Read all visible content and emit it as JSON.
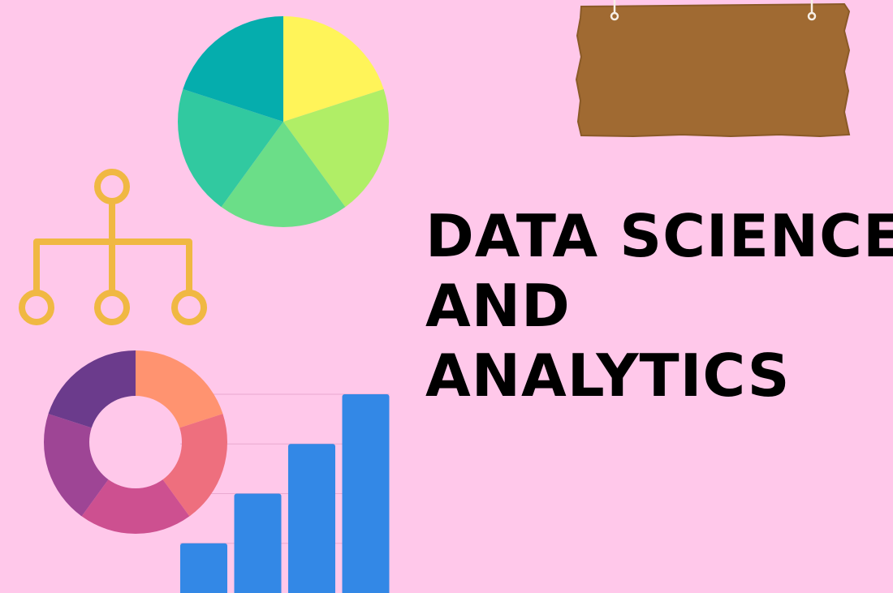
{
  "colors": {
    "background": "#ffc8ea",
    "sign_wood": "#a06a32",
    "sign_wood_dark": "#8a5a28",
    "sign_hanger": "#f7efe6",
    "hierarchy_icon": "#f0b843",
    "bars": "#3388e6",
    "title_text": "#000000",
    "pie_slices": [
      "#fff459",
      "#b0ee66",
      "#6bde88",
      "#31c9a0",
      "#05adad"
    ],
    "donut_slices": [
      "#ff9370",
      "#ee6f7e",
      "#cd5090",
      "#9e4595",
      "#6b3b8c"
    ]
  },
  "icons": {
    "sign": "wooden-sign-icon",
    "hierarchy": "org-chart-icon"
  },
  "headline": {
    "lines": [
      "DATA SCIENCE",
      "AND",
      "ANALYTICS"
    ]
  },
  "chart_data": [
    {
      "type": "pie",
      "slices": [
        {
          "color": "#fff459",
          "value": 20
        },
        {
          "color": "#b0ee66",
          "value": 20
        },
        {
          "color": "#6bde88",
          "value": 20
        },
        {
          "color": "#31c9a0",
          "value": 20
        },
        {
          "color": "#05adad",
          "value": 20
        }
      ]
    },
    {
      "type": "pie",
      "subtype": "donut",
      "slices": [
        {
          "color": "#ff9370",
          "value": 20
        },
        {
          "color": "#ee6f7e",
          "value": 20
        },
        {
          "color": "#cd5090",
          "value": 20
        },
        {
          "color": "#9e4595",
          "value": 20
        },
        {
          "color": "#6b3b8c",
          "value": 20
        }
      ]
    },
    {
      "type": "bar",
      "values": [
        1,
        2,
        3,
        4
      ],
      "color": "#3388e6",
      "grid": true,
      "axes_shown": false
    }
  ]
}
